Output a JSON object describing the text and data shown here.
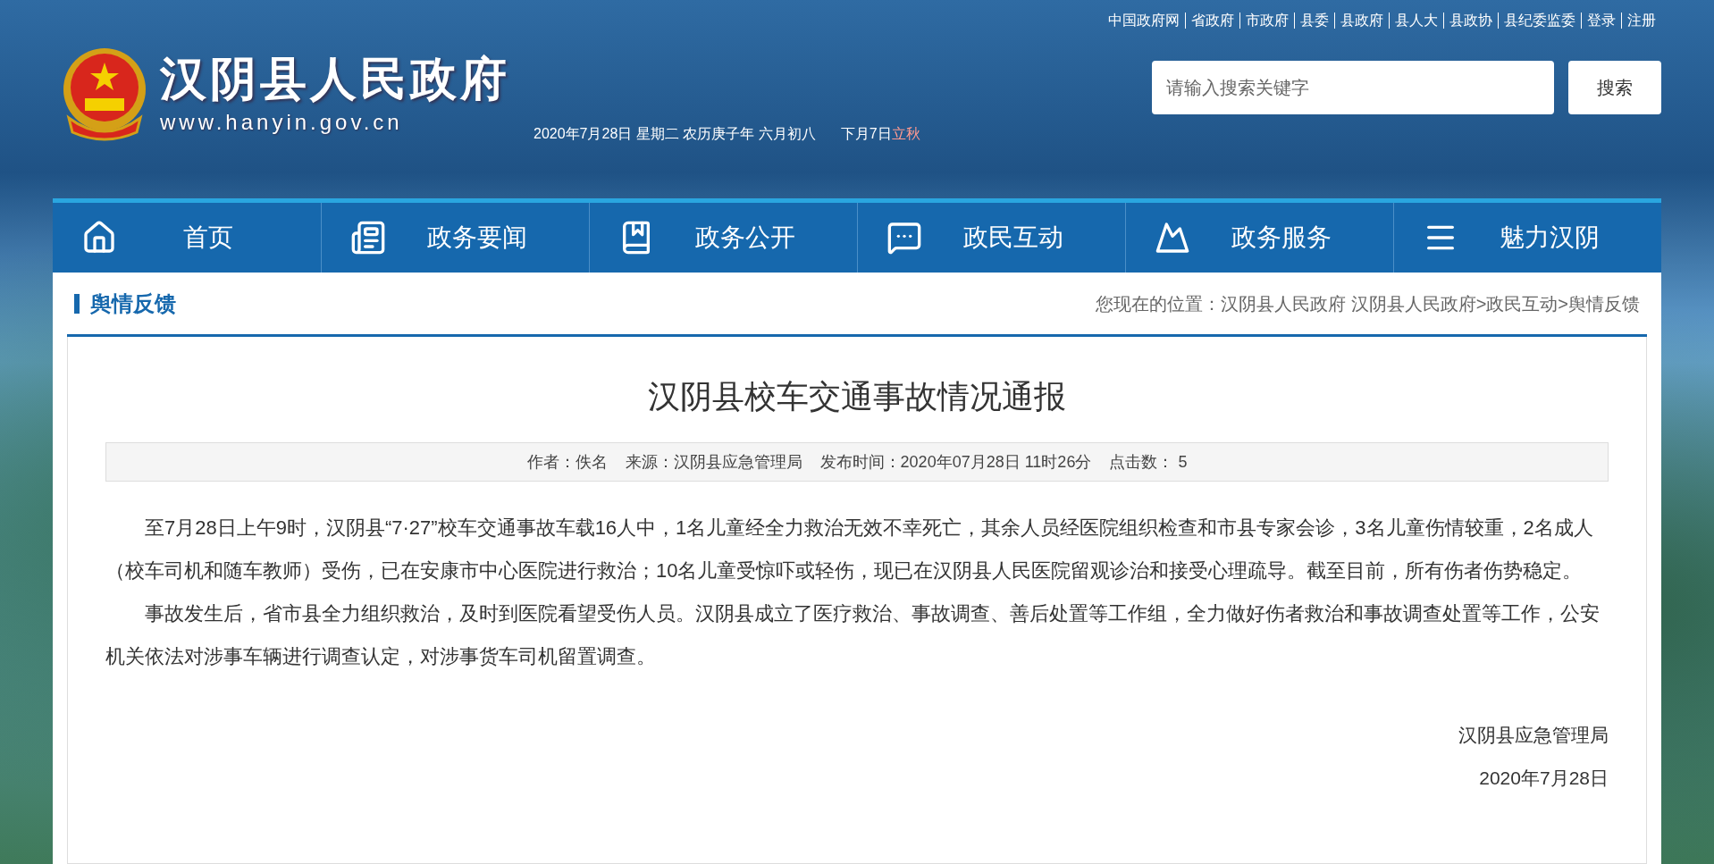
{
  "top_links": [
    "中国政府网",
    "省政府",
    "市政府",
    "县委",
    "县政府",
    "县人大",
    "县政协",
    "县纪委监委",
    "登录",
    "注册"
  ],
  "site": {
    "name": "汉阴县人民政府",
    "url": "www.hanyin.gov.cn"
  },
  "date_line": {
    "text": "2020年7月28日 星期二 农历庚子年 六月初八",
    "next_term_prefix": "下月7日",
    "next_term": "立秋"
  },
  "search": {
    "placeholder": "请输入搜索关键字",
    "button": "搜索"
  },
  "nav": [
    "首页",
    "政务要闻",
    "政务公开",
    "政民互动",
    "政务服务",
    "魅力汉阴"
  ],
  "section_title": "舆情反馈",
  "breadcrumb": "您现在的位置：汉阴县人民政府 汉阴县人民政府>政民互动>舆情反馈",
  "article": {
    "title": "汉阴县校车交通事故情况通报",
    "meta": [
      "作者：佚名",
      "来源：汉阴县应急管理局",
      "发布时间：2020年07月28日 11时26分",
      "点击数： 5"
    ],
    "paragraphs": [
      "至7月28日上午9时，汉阴县“7·27”校车交通事故车载16人中，1名儿童经全力救治无效不幸死亡，其余人员经医院组织检查和市县专家会诊，3名儿童伤情较重，2名成人（校车司机和随车教师）受伤，已在安康市中心医院进行救治；10名儿童受惊吓或轻伤，现已在汉阴县人民医院留观诊治和接受心理疏导。截至目前，所有伤者伤势稳定。",
      "事故发生后，省市县全力组织救治，及时到医院看望受伤人员。汉阴县成立了医疗救治、事故调查、善后处置等工作组，全力做好伤者救治和事故调查处置等工作，公安机关依法对涉事车辆进行调查认定，对涉事货车司机留置调查。"
    ],
    "signature": "汉阴县应急管理局",
    "date": "2020年7月28日"
  }
}
